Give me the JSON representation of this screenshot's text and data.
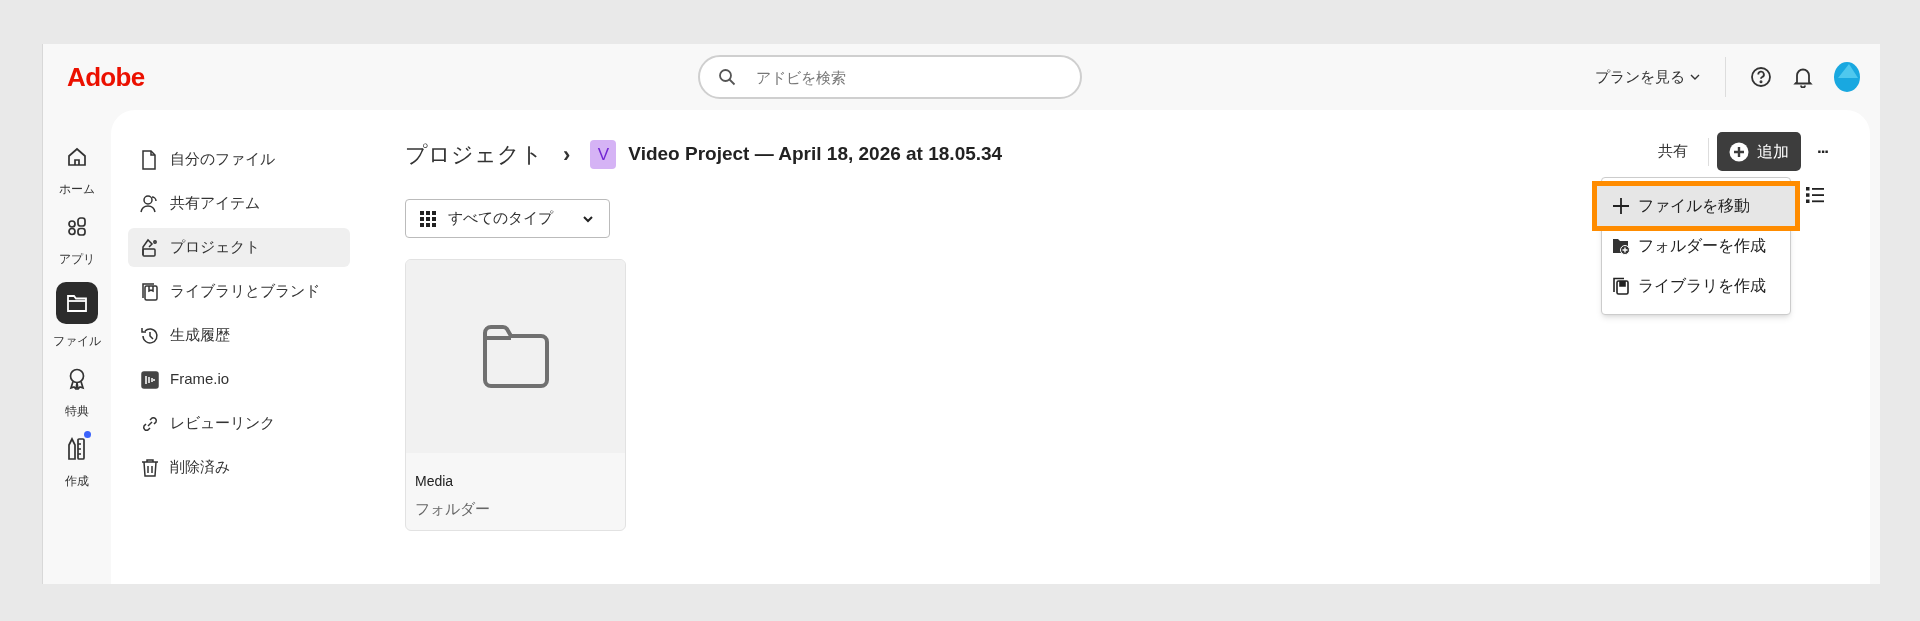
{
  "header": {
    "logo": "Adobe",
    "search": {
      "placeholder": "アドビを検索"
    },
    "plans": "プランを見る"
  },
  "rail": [
    {
      "label": "ホーム",
      "selected": false,
      "notification": false
    },
    {
      "label": "アプリ",
      "selected": false,
      "notification": false
    },
    {
      "label": "ファイル",
      "selected": true,
      "notification": false
    },
    {
      "label": "特典",
      "selected": false,
      "notification": false
    },
    {
      "label": "作成",
      "selected": false,
      "notification": true
    }
  ],
  "sidebar": {
    "items": [
      {
        "label": "自分のファイル",
        "selected": false
      },
      {
        "label": "共有アイテム",
        "selected": false
      },
      {
        "label": "プロジェクト",
        "selected": true
      },
      {
        "label": "ライブラリとブランド",
        "selected": false
      },
      {
        "label": "生成履歴",
        "selected": false
      },
      {
        "label": "Frame.io",
        "selected": false
      },
      {
        "label": "レビューリンク",
        "selected": false
      },
      {
        "label": "削除済み",
        "selected": false
      }
    ]
  },
  "breadcrumb": {
    "parent": "プロジェクト",
    "separator": "›",
    "project_badge": "V",
    "project": "Video Project — April 18, 2026 at 18.05.34"
  },
  "filter": "すべてのタイプ",
  "items": [
    {
      "name": "Media",
      "type": "フォルダー"
    }
  ],
  "actions": {
    "share": "共有",
    "add": "追加",
    "more": "···"
  },
  "add_menu": [
    {
      "label": "ファイルを移動",
      "highlighted": true
    },
    {
      "label": "フォルダーを作成",
      "highlighted": false
    },
    {
      "label": "ライブラリを作成",
      "highlighted": false
    }
  ]
}
